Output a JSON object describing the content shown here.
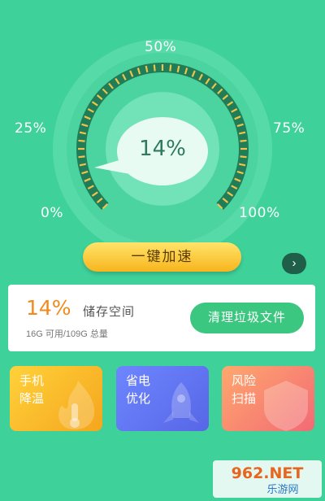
{
  "gauge": {
    "labels": {
      "p0": "0%",
      "p25": "25%",
      "p50": "50%",
      "p75": "75%",
      "p100": "100%"
    },
    "value_text": "14%",
    "value_fraction": 0.14,
    "tick_color_active": "#f2c24b",
    "track_color": "#1f7e58"
  },
  "boost": {
    "label": "一键加速"
  },
  "next": {
    "icon": "chevron-right-icon"
  },
  "storage": {
    "percent": "14%",
    "title": "储存空间",
    "detail": "16G 可用/109G 总量",
    "clean_label": "清理垃圾文件"
  },
  "features": [
    {
      "label": "手机降温",
      "icon": "thermometer-icon",
      "color": "#f8b72a"
    },
    {
      "label": "省电优化",
      "icon": "rocket-icon",
      "color": "#6176f2"
    },
    {
      "label": "风险扫描",
      "icon": "shield-icon",
      "color": "#f58a70"
    }
  ],
  "watermark": {
    "top": "962.NET",
    "bottom": "乐游网"
  },
  "colors": {
    "background": "#3fd19a",
    "accent_orange": "#f08a1c",
    "clean_green": "#3cc781"
  }
}
